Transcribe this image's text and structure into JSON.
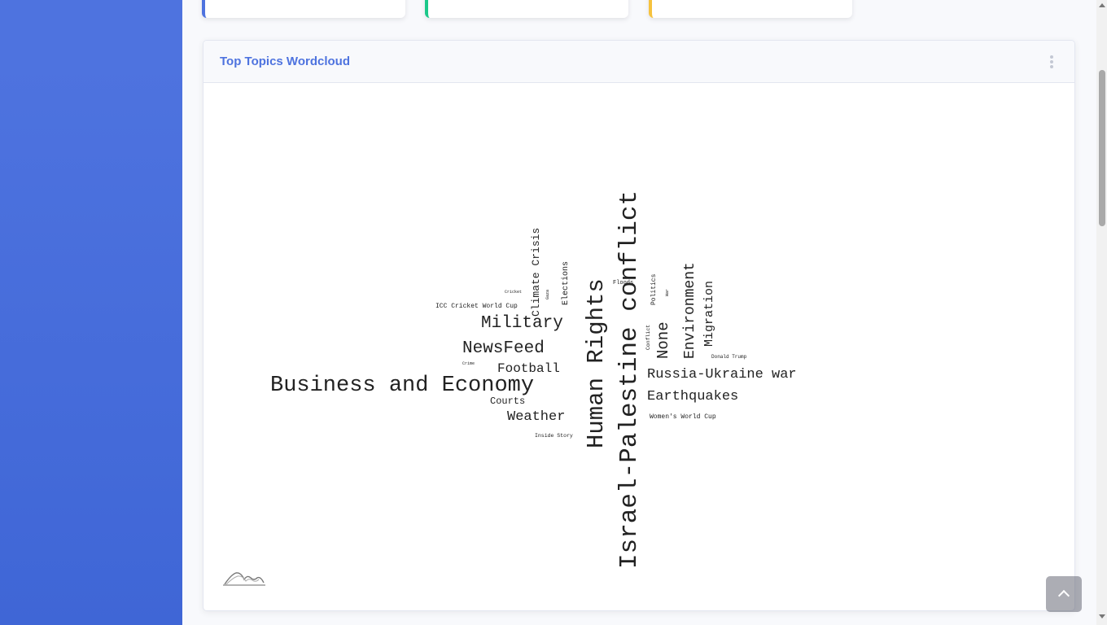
{
  "card": {
    "title": "Top Topics Wordcloud",
    "menu_icon": "ellipsis-vertical-icon"
  },
  "wordcloud": {
    "words": [
      {
        "text": "Israel-Palestine conflict",
        "weight": 100,
        "orientation": "vertical"
      },
      {
        "text": "Human Rights",
        "weight": 78,
        "orientation": "vertical"
      },
      {
        "text": "Business and Economy",
        "weight": 72,
        "orientation": "horizontal"
      },
      {
        "text": "Military",
        "weight": 56,
        "orientation": "horizontal"
      },
      {
        "text": "NewsFeed",
        "weight": 56,
        "orientation": "horizontal"
      },
      {
        "text": "None",
        "weight": 48,
        "orientation": "vertical"
      },
      {
        "text": "Russia-Ukraine war",
        "weight": 46,
        "orientation": "horizontal"
      },
      {
        "text": "Earthquakes",
        "weight": 46,
        "orientation": "horizontal"
      },
      {
        "text": "Environment",
        "weight": 44,
        "orientation": "vertical"
      },
      {
        "text": "Weather",
        "weight": 44,
        "orientation": "horizontal"
      },
      {
        "text": "Football",
        "weight": 42,
        "orientation": "horizontal"
      },
      {
        "text": "Migration",
        "weight": 40,
        "orientation": "vertical"
      },
      {
        "text": "Climate Crisis",
        "weight": 34,
        "orientation": "vertical"
      },
      {
        "text": "Courts",
        "weight": 32,
        "orientation": "horizontal"
      },
      {
        "text": "Elections",
        "weight": 26,
        "orientation": "vertical"
      },
      {
        "text": "ICC Cricket World Cup",
        "weight": 22,
        "orientation": "horizontal"
      },
      {
        "text": "Women's World Cup",
        "weight": 22,
        "orientation": "horizontal"
      },
      {
        "text": "Floods",
        "weight": 20,
        "orientation": "horizontal"
      },
      {
        "text": "Politics",
        "weight": 20,
        "orientation": "vertical"
      },
      {
        "text": "Inside Story",
        "weight": 18,
        "orientation": "horizontal"
      },
      {
        "text": "Donald Trump",
        "weight": 16,
        "orientation": "horizontal"
      },
      {
        "text": "Conflict",
        "weight": 16,
        "orientation": "vertical"
      },
      {
        "text": "Cricket",
        "weight": 14,
        "orientation": "horizontal"
      },
      {
        "text": "Crime",
        "weight": 14,
        "orientation": "horizontal"
      },
      {
        "text": "Gaza",
        "weight": 12,
        "orientation": "vertical"
      },
      {
        "text": "War",
        "weight": 12,
        "orientation": "vertical"
      }
    ]
  },
  "colors": {
    "sidebar": "#4e73df",
    "accent": "#4e73df",
    "card_border_green": "#1cc88a",
    "card_border_yellow": "#f6c23e"
  },
  "icons": {
    "scroll_top": "chevron-up-icon",
    "logo": "wave-logo-icon"
  }
}
